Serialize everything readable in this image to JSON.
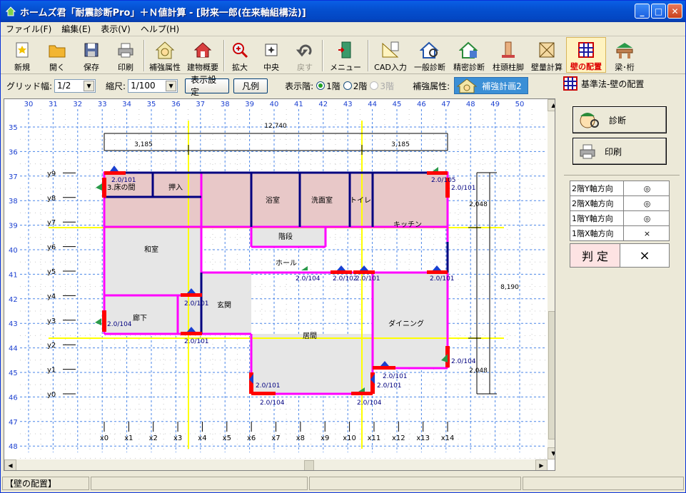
{
  "window": {
    "title": "ホームズ君「耐震診断Pro」＋Ｎ値計算 - [財来一郎(在来軸組構法)]"
  },
  "menu": [
    {
      "label": "ファイル(F)"
    },
    {
      "label": "編集(E)"
    },
    {
      "label": "表示(V)"
    },
    {
      "label": "ヘルプ(H)"
    }
  ],
  "toolbar": [
    {
      "label": "新規",
      "icon": "new-icon"
    },
    {
      "label": "開く",
      "icon": "open-folder-icon"
    },
    {
      "label": "保存",
      "icon": "save-disk-icon"
    },
    {
      "label": "印刷",
      "icon": "printer-icon"
    },
    {
      "label": "補強属性",
      "icon": "reinforce-house-icon"
    },
    {
      "label": "建物概要",
      "icon": "house-icon"
    },
    {
      "label": "拡大",
      "icon": "zoom-in-icon"
    },
    {
      "label": "中央",
      "icon": "center-icon"
    },
    {
      "label": "戻す",
      "icon": "undo-icon"
    },
    {
      "label": "メニュー",
      "icon": "menu-door-icon"
    },
    {
      "label": "CAD入力",
      "icon": "cad-input-icon"
    },
    {
      "label": "一般診断",
      "icon": "general-diagnosis-icon"
    },
    {
      "label": "精密診断",
      "icon": "precise-diagnosis-icon"
    },
    {
      "label": "柱頭柱脚",
      "icon": "column-joint-icon"
    },
    {
      "label": "壁量計算",
      "icon": "wall-quantity-icon"
    },
    {
      "label": "壁の配置",
      "icon": "wall-layout-icon"
    },
    {
      "label": "梁･桁",
      "icon": "beam-icon"
    }
  ],
  "options": {
    "grid_label": "グリッド幅:",
    "grid_value": "1/2",
    "scale_label": "縮尺:",
    "scale_value": "1/100",
    "display_settings": "表示設定",
    "legend": "凡例",
    "floor_label": "表示階:",
    "floor_1": "1階",
    "floor_2": "2階",
    "floor_3": "3階",
    "reinforce_label": "補強属性:",
    "reinforce_value": "補強計画2"
  },
  "plan": {
    "col_labels": [
      "30",
      "31",
      "32",
      "33",
      "34",
      "35",
      "36",
      "37",
      "38",
      "39",
      "40",
      "41",
      "42",
      "43",
      "44",
      "45",
      "46",
      "47",
      "48",
      "49",
      "50"
    ],
    "row_labels": [
      "35",
      "36",
      "37",
      "38",
      "39",
      "40",
      "41",
      "42",
      "43",
      "44",
      "45",
      "46",
      "47",
      "48"
    ],
    "x_axes": [
      "x0",
      "x1",
      "x2",
      "x3",
      "x4",
      "x5",
      "x6",
      "x7",
      "x8",
      "x9",
      "x10",
      "x11",
      "x12",
      "x13",
      "x14"
    ],
    "y_axes": [
      "y0",
      "y1",
      "y2",
      "y3",
      "y4",
      "y5",
      "y6",
      "y7",
      "y8",
      "y9"
    ],
    "dim_total": "12,740",
    "dim_left": "3,185",
    "dim_right": "3,185",
    "dim_h_total": "8,190",
    "dim_h_top": "2,048",
    "dim_h_bottom": "2,048",
    "rooms": {
      "closet_3": "3.床の間",
      "oshiire": "押入",
      "bath": "浴室",
      "washroom": "洗面室",
      "toilet": "トイレ",
      "kitchen": "キッチン",
      "stairs": "階段",
      "washitsu": "和室",
      "hall": "ホール",
      "entrance": "玄関",
      "corridor": "廊下",
      "dining": "ダイニング",
      "living": "居間"
    },
    "wall_labels": [
      "2.0/101",
      "2.0/105",
      "2.0/101",
      "2.0/104",
      "2.0/102",
      "2.0/101",
      "2.0/101",
      "2.0/101",
      "2.0/104",
      "2.0/101",
      "2.0/104",
      "2.0/101",
      "2.0/101",
      "2.0/101",
      "2.0/104",
      "2.0/104",
      "2.0/101",
      "2.0/101"
    ]
  },
  "panel": {
    "title": "基準法-壁の配置",
    "diagnose": "診断",
    "print": "印刷",
    "rows": [
      {
        "label": "2階Y軸方向",
        "mark": "◎"
      },
      {
        "label": "2階X軸方向",
        "mark": "◎"
      },
      {
        "label": "1階Y軸方向",
        "mark": "◎"
      },
      {
        "label": "1階X軸方向",
        "mark": "×"
      }
    ],
    "verdict_label": "判 定",
    "verdict_value": "×"
  },
  "status": {
    "mode": "【壁の配置】"
  },
  "colors": {
    "wall_magenta": "#ff00ff",
    "wall_navy": "#000080",
    "axis_yellow": "#ffff00",
    "room_pink": "#e8c8c8",
    "room_gray": "#e6e6e6"
  }
}
